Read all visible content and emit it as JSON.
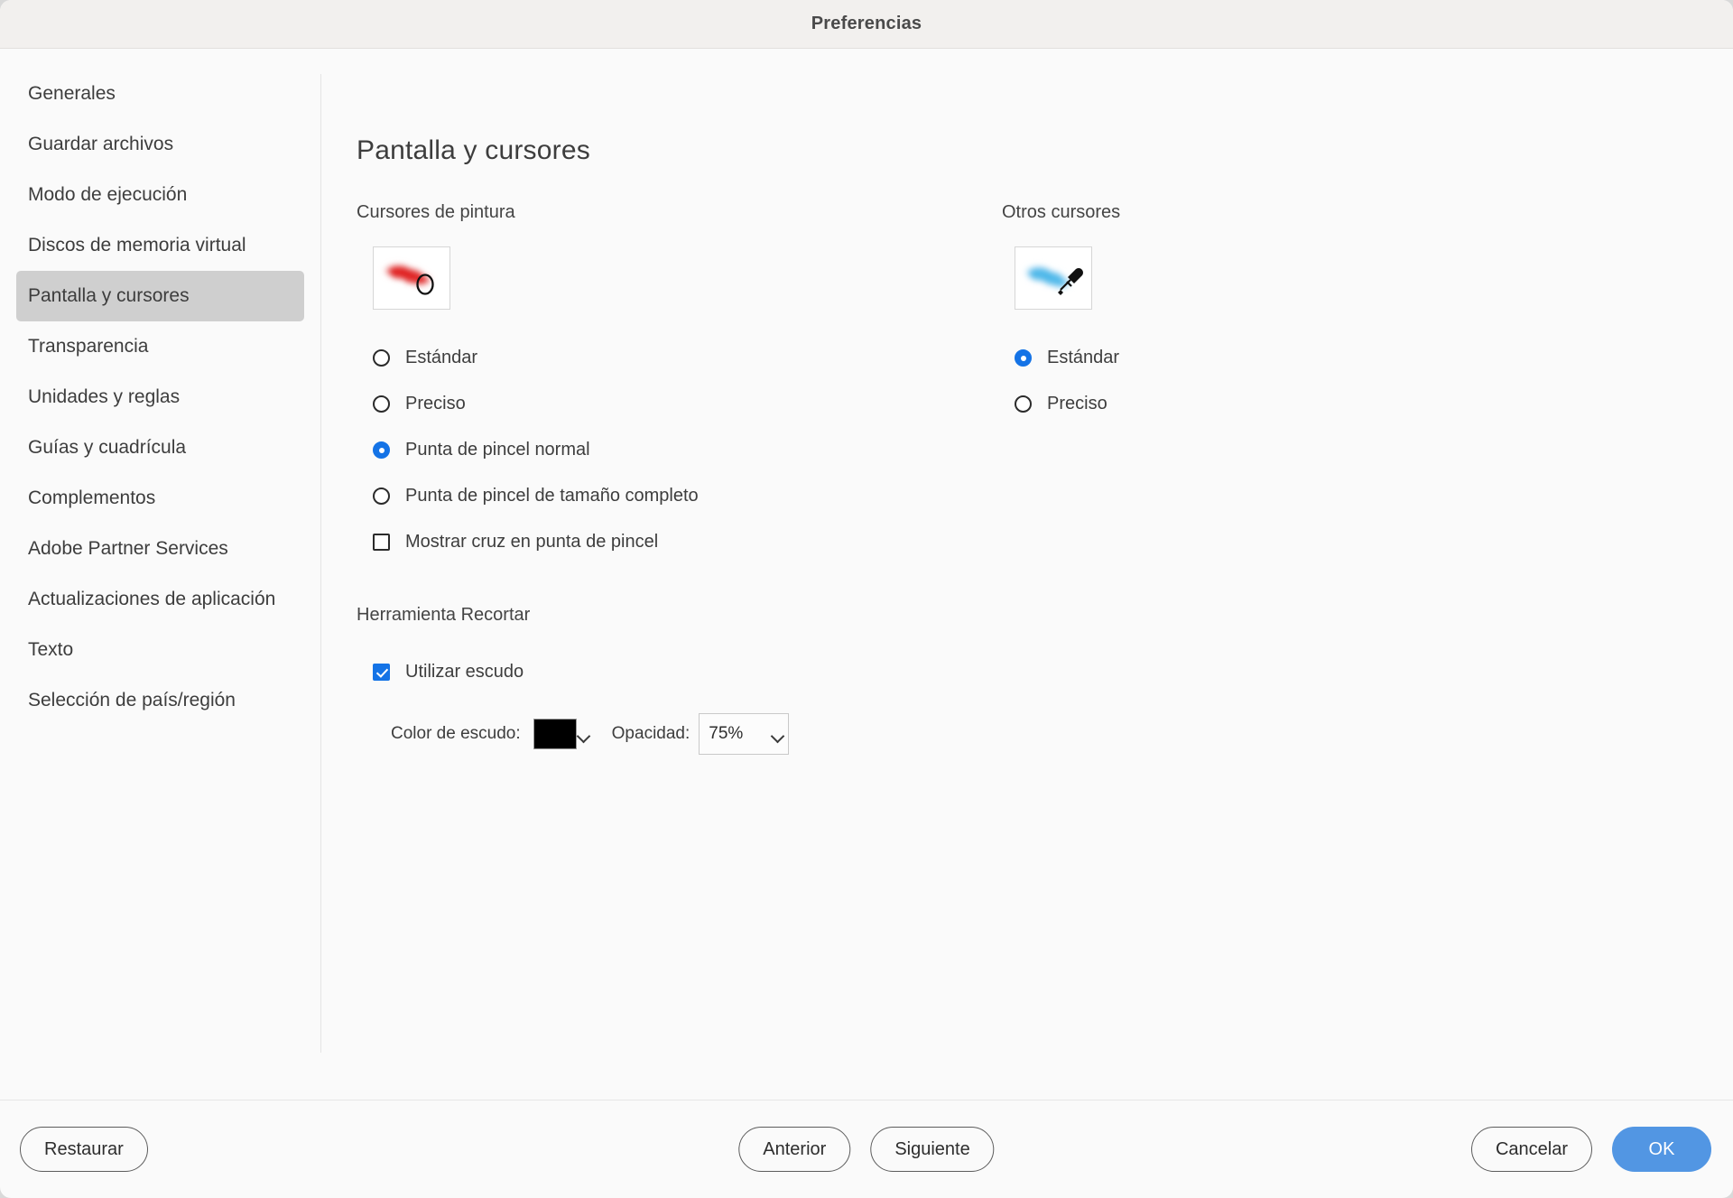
{
  "window": {
    "title": "Preferencias"
  },
  "sidebar": {
    "items": [
      {
        "label": "Generales",
        "selected": false
      },
      {
        "label": "Guardar archivos",
        "selected": false
      },
      {
        "label": "Modo de ejecución",
        "selected": false
      },
      {
        "label": "Discos de memoria virtual",
        "selected": false
      },
      {
        "label": "Pantalla y cursores",
        "selected": true
      },
      {
        "label": "Transparencia",
        "selected": false
      },
      {
        "label": "Unidades y reglas",
        "selected": false
      },
      {
        "label": "Guías y cuadrícula",
        "selected": false
      },
      {
        "label": "Complementos",
        "selected": false
      },
      {
        "label": "Adobe Partner Services",
        "selected": false
      },
      {
        "label": "Actualizaciones de aplicación",
        "selected": false
      },
      {
        "label": "Texto",
        "selected": false
      },
      {
        "label": "Selección de país/región",
        "selected": false
      }
    ]
  },
  "main": {
    "page_title": "Pantalla y cursores",
    "paint_cursors": {
      "group_label": "Cursores de pintura",
      "preview_alt": "brush-stroke-preview",
      "options": [
        {
          "label": "Estándar",
          "selected": false
        },
        {
          "label": "Preciso",
          "selected": false
        },
        {
          "label": "Punta de pincel normal",
          "selected": true
        },
        {
          "label": "Punta de pincel de tamaño completo",
          "selected": false
        }
      ],
      "checkbox": {
        "label": "Mostrar cruz en punta de pincel",
        "checked": false
      }
    },
    "crop_tool": {
      "group_label": "Herramienta Recortar",
      "use_shield": {
        "label": "Utilizar escudo",
        "checked": true
      },
      "shield_color_label": "Color de escudo:",
      "shield_color_value": "#000000",
      "opacity_label": "Opacidad:",
      "opacity_value": "75%"
    },
    "other_cursors": {
      "group_label": "Otros cursores",
      "preview_alt": "eyedropper-preview",
      "options": [
        {
          "label": "Estándar",
          "selected": true
        },
        {
          "label": "Preciso",
          "selected": false
        }
      ]
    }
  },
  "footer": {
    "restore": "Restaurar",
    "previous": "Anterior",
    "next": "Siguiente",
    "cancel": "Cancelar",
    "ok": "OK"
  },
  "colors": {
    "accent": "#1473e6",
    "primary_button": "#5296e3",
    "selected_nav": "#cfcfcf",
    "titlebar": "#f2f0ee",
    "dialog_bg": "#fafafa",
    "brush_preview": "#e02020",
    "eyedropper_preview": "#4ab6e8"
  }
}
